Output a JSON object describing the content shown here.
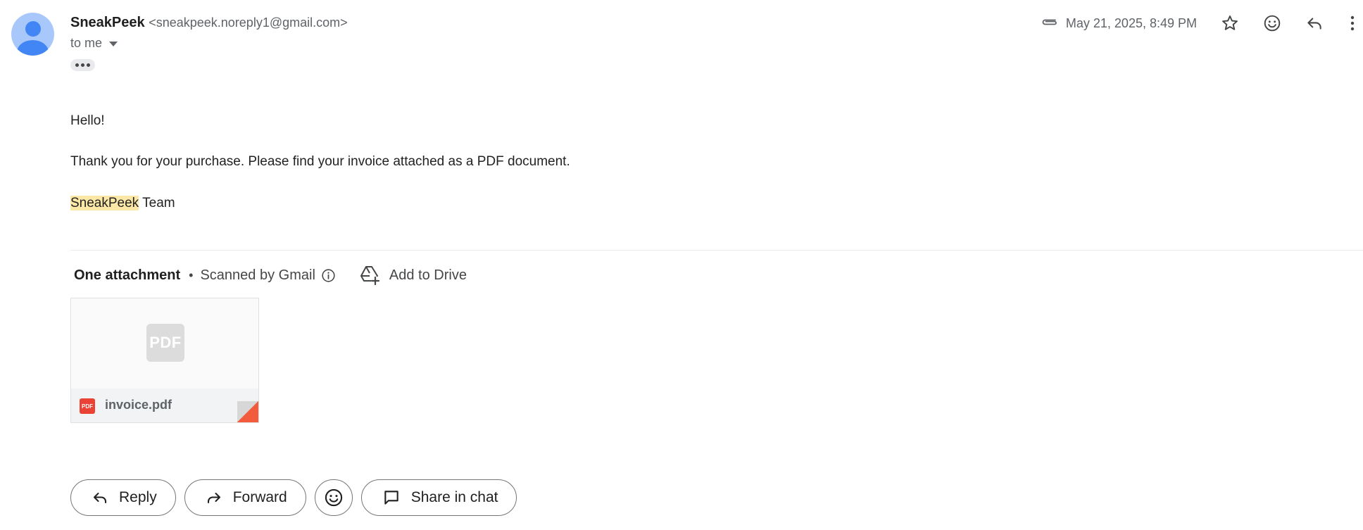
{
  "sender": {
    "name": "SneakPeek",
    "email": "<sneakpeek.noreply1@gmail.com>",
    "to_label": "to me"
  },
  "header": {
    "date": "May 21, 2025, 8:49 PM",
    "icons": [
      "attachment-icon",
      "star-icon",
      "emoji-icon",
      "reply-icon",
      "more-vert-icon"
    ]
  },
  "body": {
    "greeting": "Hello!",
    "message": "Thank you for your purchase. Please find your invoice attached as a PDF document.",
    "signature_highlight": "SneakPeek",
    "signature_rest": " Team"
  },
  "attachments": {
    "title": "One attachment",
    "separator": "•",
    "scanned": "Scanned by Gmail",
    "add_to_drive": "Add to Drive",
    "thumb_label": "PDF",
    "badge_label": "PDF",
    "file_name": "invoice.pdf"
  },
  "actions": {
    "reply": "Reply",
    "forward": "Forward",
    "share": "Share in chat"
  },
  "colors": {
    "highlight": "#fce8a6",
    "avatar_bg": "#a8c7fa",
    "avatar_fg": "#4285f4",
    "pdf_red": "#ea4335",
    "corner_orange": "#f25b3b"
  }
}
